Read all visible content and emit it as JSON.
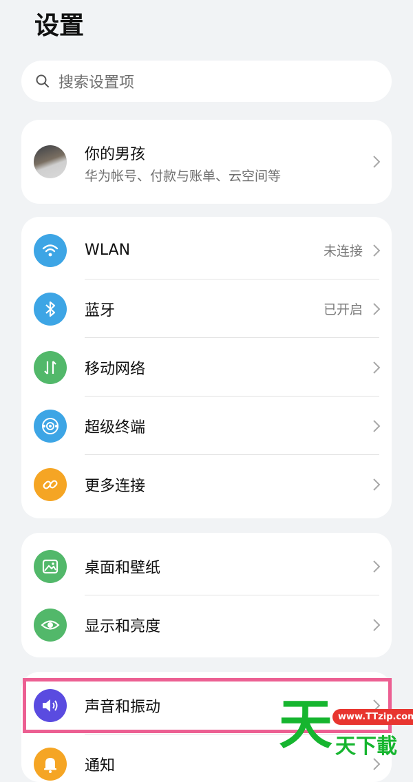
{
  "header": {
    "title": "设置"
  },
  "search": {
    "placeholder": "搜索设置项",
    "icon": "search-icon"
  },
  "account": {
    "name": "你的男孩",
    "subtitle": "华为帐号、付款与账单、云空间等"
  },
  "groups": [
    {
      "items": [
        {
          "label": "WLAN",
          "value": "未连接",
          "icon": "wifi-icon",
          "color": "#3da5e5"
        },
        {
          "label": "蓝牙",
          "value": "已开启",
          "icon": "bluetooth-icon",
          "color": "#3da5e5"
        },
        {
          "label": "移动网络",
          "value": "",
          "icon": "mobile-data-icon",
          "color": "#52b86a"
        },
        {
          "label": "超级终端",
          "value": "",
          "icon": "super-device-icon",
          "color": "#3da5e5"
        },
        {
          "label": "更多连接",
          "value": "",
          "icon": "link-icon",
          "color": "#f5a524"
        }
      ]
    },
    {
      "items": [
        {
          "label": "桌面和壁纸",
          "value": "",
          "icon": "wallpaper-icon",
          "color": "#52b86a"
        },
        {
          "label": "显示和亮度",
          "value": "",
          "icon": "eye-icon",
          "color": "#52b86a"
        }
      ]
    },
    {
      "items": [
        {
          "label": "声音和振动",
          "value": "",
          "icon": "speaker-icon",
          "color": "#5a4be0"
        },
        {
          "label": "通知",
          "value": "",
          "icon": "bell-icon",
          "color": "#f5a524"
        }
      ]
    }
  ],
  "watermark": {
    "url": "www.TTzip.com",
    "big": "天",
    "small": "天下載"
  }
}
